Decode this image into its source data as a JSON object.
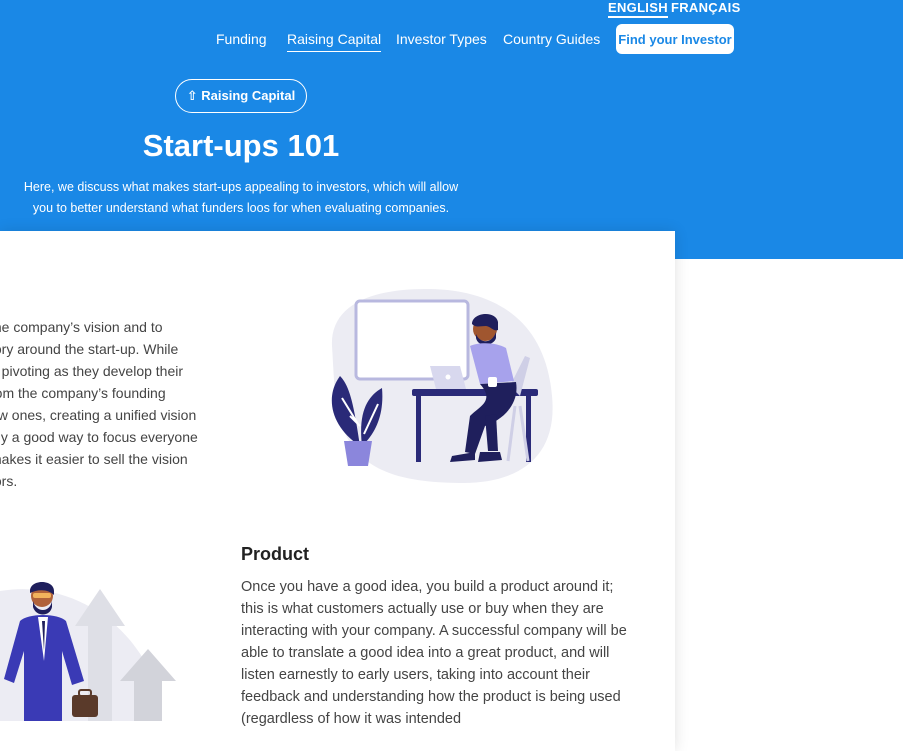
{
  "language": {
    "english": "ENGLISH",
    "french": "FRANÇAIS"
  },
  "nav": {
    "items": [
      "Funding",
      "Raising Capital",
      "Investor Types",
      "Country Guides"
    ],
    "cta": "Find your Investor"
  },
  "hero": {
    "category_pill": "⇧ Raising Capital",
    "title": "Start-ups 101",
    "subtitle_lines": [
      "Here, we discuss what makes start-ups appealing to investors, which will allow",
      "you to better understand what funders loos for when evaluating companies."
    ]
  },
  "vision_section": {
    "lines": [
      "the company’s vision and to",
      "tory around the start-up. While",
      "o pivoting as they develop their",
      "rom the company’s founding",
      "ew ones, creating a unified vision",
      "nly a good way to focus everyone",
      "makes it easier to sell the vision",
      "tors."
    ]
  },
  "product_section": {
    "heading": "Product",
    "body": "Once you have a good idea, you build a product around it; this is what customers actually use or buy when they are interacting with your company. A successful company will be able to translate a good idea into a great product, and will listen earnestly to early users, taking into account their feedback and understanding how the product is being used (regardless of how it was intended"
  },
  "colors": {
    "brand_blue": "#1a88e6",
    "illustration_purple": "#7c7ce0",
    "illustration_navy": "#1f1f5c"
  }
}
